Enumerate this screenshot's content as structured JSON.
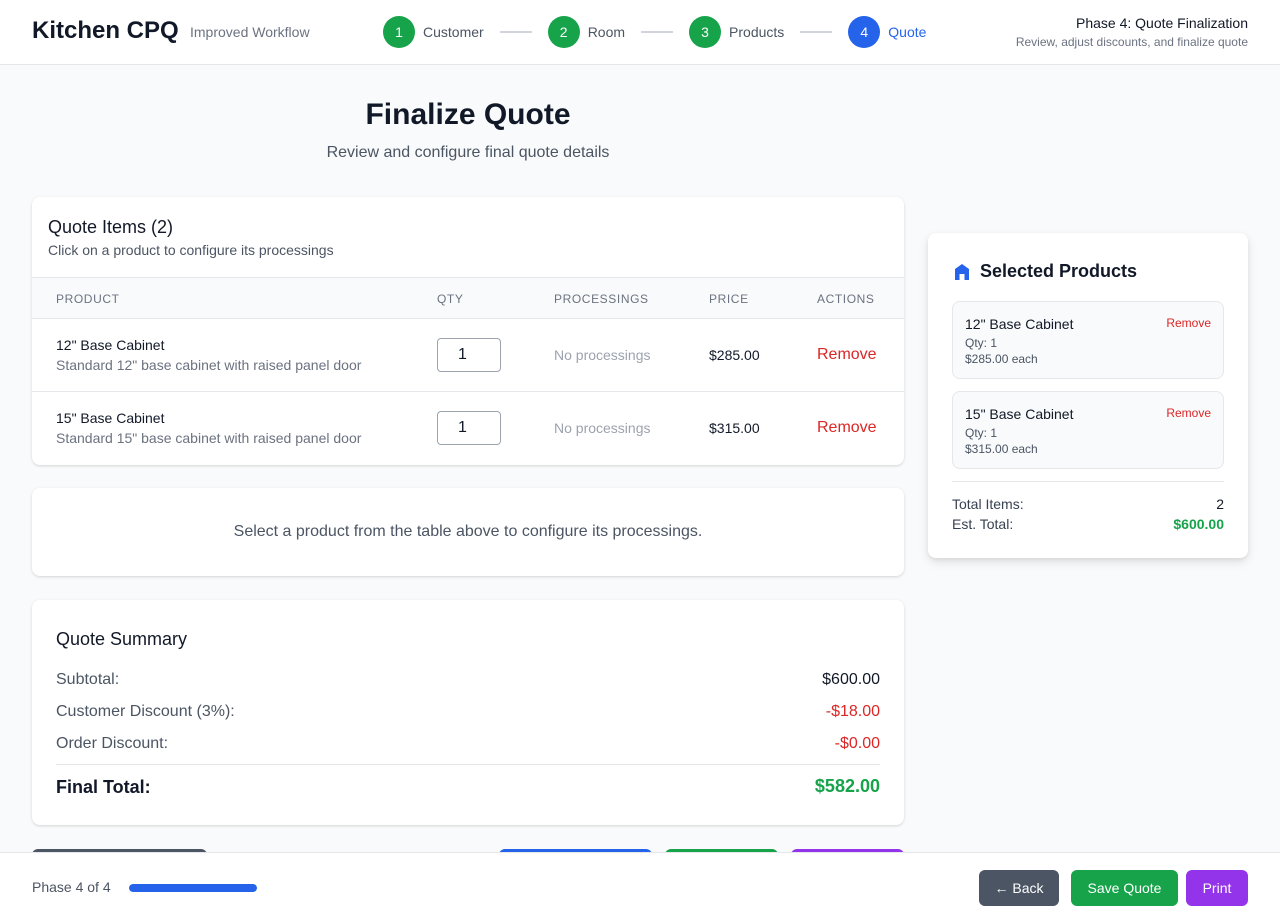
{
  "app": {
    "title": "Kitchen CPQ",
    "subtitle": "Improved Workflow"
  },
  "stepper": {
    "steps": [
      {
        "number": "1",
        "label": "Customer",
        "state": "complete"
      },
      {
        "number": "2",
        "label": "Room",
        "state": "complete"
      },
      {
        "number": "3",
        "label": "Products",
        "state": "complete"
      },
      {
        "number": "4",
        "label": "Quote",
        "state": "active"
      }
    ]
  },
  "phase": {
    "title": "Phase 4: Quote Finalization",
    "description": "Review, adjust discounts, and finalize quote"
  },
  "page": {
    "title": "Finalize Quote",
    "subtitle": "Review and configure final quote details"
  },
  "quote_items": {
    "title": "Quote Items (2)",
    "help": "Click on a product to configure its processings",
    "columns": [
      "Product",
      "Qty",
      "Processings",
      "Price",
      "Actions"
    ],
    "rows": [
      {
        "name": "12\" Base Cabinet",
        "description": "Standard 12\" base cabinet with raised panel door",
        "qty": "1",
        "processings": "No processings",
        "price": "$285.00",
        "action": "Remove"
      },
      {
        "name": "15\" Base Cabinet",
        "description": "Standard 15\" base cabinet with raised panel door",
        "qty": "1",
        "processings": "No processings",
        "price": "$315.00",
        "action": "Remove"
      }
    ]
  },
  "processing_panel": {
    "message": "Select a product from the table above to configure its processings."
  },
  "summary": {
    "title": "Quote Summary",
    "subtotal_label": "Subtotal:",
    "subtotal_value": "$600.00",
    "customer_discount_label": "Customer Discount (3%):",
    "customer_discount_value": "-$18.00",
    "order_discount_label": "Order Discount:",
    "order_discount_value": "-$0.00",
    "final_label": "Final Total:",
    "final_value": "$582.00"
  },
  "sidebar": {
    "title": "Selected Products",
    "icon": "home-icon",
    "items": [
      {
        "name": "12\" Base Cabinet",
        "qty": "Qty: 1",
        "price": "$285.00 each",
        "remove": "Remove"
      },
      {
        "name": "15\" Base Cabinet",
        "qty": "Qty: 1",
        "price": "$315.00 each",
        "remove": "Remove"
      }
    ],
    "total_items_label": "Total Items:",
    "total_items_value": "2",
    "est_total_label": "Est. Total:",
    "est_total_value": "$600.00"
  },
  "footer": {
    "phase_count": "Phase 4 of 4",
    "progress": 1.0,
    "back_label": "← Back",
    "save_label": "Save Quote",
    "print_label": "Print"
  },
  "colors": {
    "complete": "#16a34a",
    "active": "#2563eb",
    "danger": "#dc2626",
    "print": "#9333ea",
    "neutral_button": "#4b5563"
  }
}
